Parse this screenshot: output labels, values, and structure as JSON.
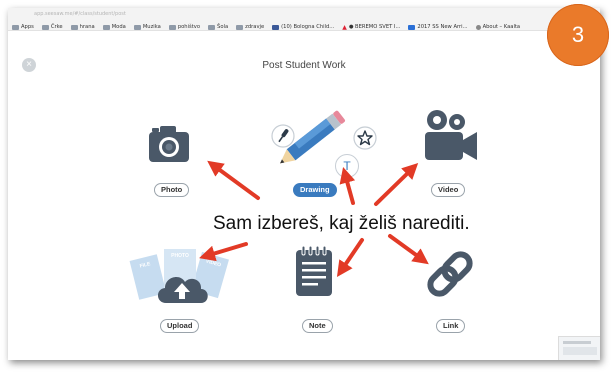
{
  "browser": {
    "url": "app.seesaw.me/#/class/student/post",
    "bookmarks": [
      {
        "label": "Apps",
        "icon": "apps-grid-icon"
      },
      {
        "label": "Črke",
        "icon": "folder-icon"
      },
      {
        "label": "hrana",
        "icon": "folder-icon"
      },
      {
        "label": "Moda",
        "icon": "folder-icon"
      },
      {
        "label": "Muzika",
        "icon": "folder-icon"
      },
      {
        "label": "pohištvo",
        "icon": "folder-icon"
      },
      {
        "label": "Šola",
        "icon": "folder-icon"
      },
      {
        "label": "zdravje",
        "icon": "folder-icon"
      },
      {
        "label": "(10) Bologna Child...",
        "icon": "facebook-icon"
      },
      {
        "label": "● BEREMO SVET I...",
        "icon": "warning-icon"
      },
      {
        "label": "2017 SS New Arri...",
        "icon": "page-icon"
      },
      {
        "label": "About – Kaalta",
        "icon": "globe-icon"
      }
    ]
  },
  "header": {
    "title": "Post Student Work",
    "close_icon": "×"
  },
  "badge": {
    "number": "3",
    "color": "#ea7a2a"
  },
  "options": {
    "photo": "Photo",
    "drawing": "Drawing",
    "video": "Video",
    "upload": "Upload",
    "note": "Note",
    "link": "Link"
  },
  "upload_cards": {
    "file": "FILE",
    "photo": "PHOTO",
    "video": "VIDEO"
  },
  "drawing_tool": {
    "text_tool": "T"
  },
  "overlay": {
    "text": "Sam izbereš, kaj želiš narediti."
  },
  "colors": {
    "icon_dark": "#4a5868",
    "accent_blue": "#3a7bbf",
    "arrow_red": "#e23a26"
  }
}
